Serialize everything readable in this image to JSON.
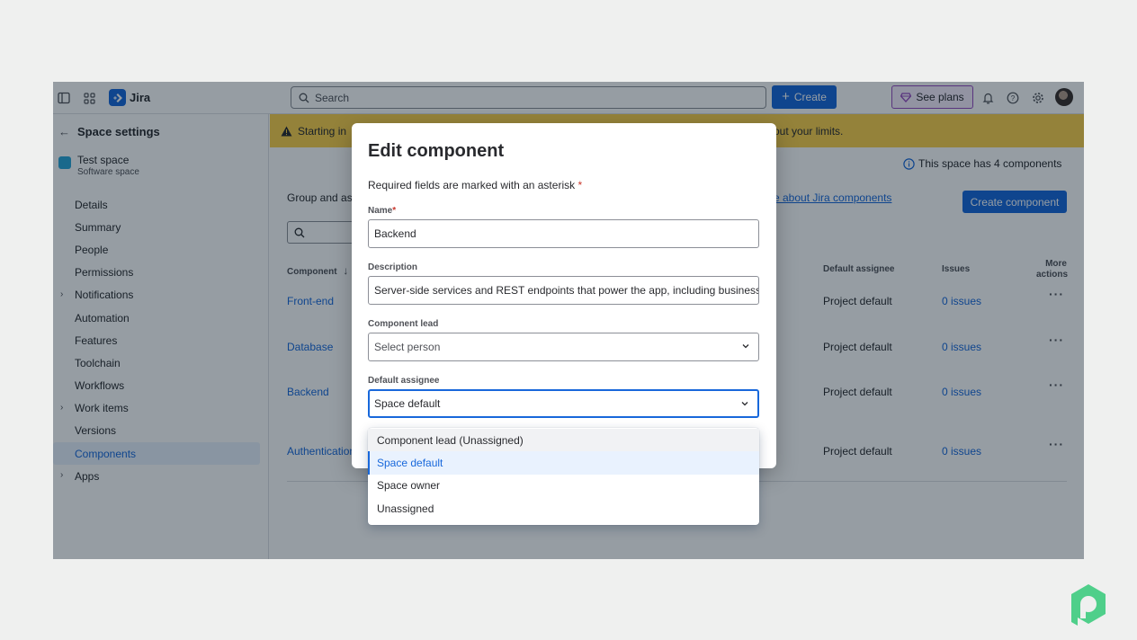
{
  "topbar": {
    "brand": "Jira",
    "search_placeholder": "Search",
    "create_label": "Create",
    "plans_label": "See plans"
  },
  "sidebar": {
    "back_title": "Space settings",
    "space_name": "Test space",
    "space_type": "Software space",
    "items": [
      {
        "label": "Details",
        "expandable": false,
        "active": false
      },
      {
        "label": "Summary",
        "expandable": false,
        "active": false
      },
      {
        "label": "People",
        "expandable": false,
        "active": false
      },
      {
        "label": "Permissions",
        "expandable": false,
        "active": false
      },
      {
        "label": "Notifications",
        "expandable": true,
        "active": false
      },
      {
        "label": "Automation",
        "expandable": false,
        "active": false
      },
      {
        "label": "Features",
        "expandable": false,
        "active": false
      },
      {
        "label": "Toolchain",
        "expandable": false,
        "active": false
      },
      {
        "label": "Workflows",
        "expandable": false,
        "active": false
      },
      {
        "label": "Work items",
        "expandable": true,
        "active": false
      },
      {
        "label": "Versions",
        "expandable": false,
        "active": false
      },
      {
        "label": "Components",
        "expandable": false,
        "active": true
      },
      {
        "label": "Apps",
        "expandable": true,
        "active": false
      }
    ]
  },
  "main": {
    "banner_start": "Starting in",
    "banner_end": "out your limits.",
    "count_note": "This space has 4 components",
    "group_text": "Group and ass",
    "learn_link": "e about Jira components",
    "create_component": "Create component",
    "columns": {
      "component": "Component",
      "default_assignee": "Default assignee",
      "issues": "Issues",
      "more_actions_1": "More",
      "more_actions_2": "actions"
    },
    "rows": [
      {
        "name": "Front-end",
        "assignee": "Project default",
        "issues": "0 issues"
      },
      {
        "name": "Database",
        "assignee": "Project default",
        "issues": "0 issues"
      },
      {
        "name": "Backend",
        "assignee": "Project default",
        "issues": "0 issues"
      },
      {
        "name": "Authentication",
        "assignee": "Project default",
        "issues": "0 issues"
      }
    ]
  },
  "modal": {
    "title": "Edit component",
    "required_note": "Required fields are marked with an asterisk",
    "name_label": "Name",
    "name_value": "Backend",
    "description_label": "Description",
    "description_value": "Server-side services and REST endpoints that power the app, including business logic",
    "lead_label": "Component lead",
    "lead_placeholder": "Select person",
    "assignee_label": "Default assignee",
    "assignee_value": "Space default",
    "options": [
      {
        "label": "Component lead (Unassigned)",
        "state": "hover"
      },
      {
        "label": "Space default",
        "state": "selected"
      },
      {
        "label": "Space owner",
        "state": ""
      },
      {
        "label": "Unassigned",
        "state": ""
      }
    ]
  },
  "colors": {
    "primary": "#1868db",
    "banner": "#fcd04a",
    "brand_mark": "#4fcf8a"
  }
}
